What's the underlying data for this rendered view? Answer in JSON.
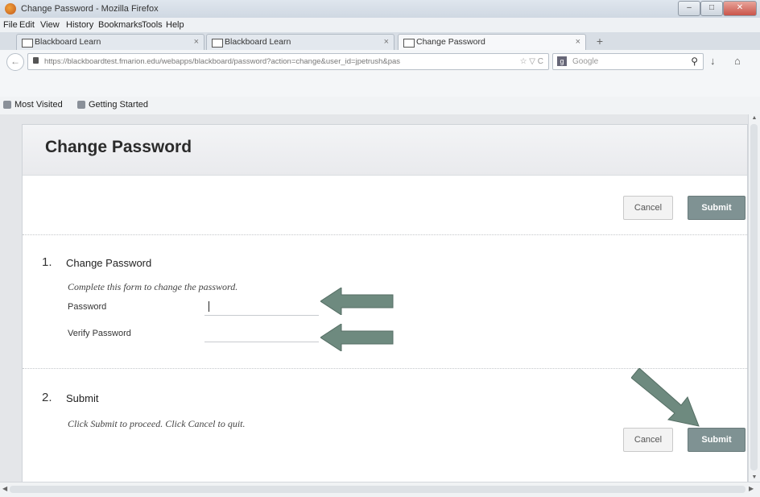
{
  "window": {
    "title": "Change Password - Mozilla Firefox",
    "controls": {
      "minimize": "–",
      "maximize": "□",
      "close": "✕"
    }
  },
  "menu": [
    "File",
    "Edit",
    "View",
    "History",
    "Bookmarks",
    "Tools",
    "Help"
  ],
  "tabs": [
    {
      "label": "Blackboard Learn",
      "close": "×"
    },
    {
      "label": "Blackboard Learn",
      "close": "×"
    },
    {
      "label": "Change Password",
      "close": "×"
    }
  ],
  "new_tab": "+",
  "nav": {
    "url": "https://blackboardtest.fmarion.edu/webapps/blackboard/password?action=change&user_id=jpetrush&pas",
    "search_engine": "Google",
    "search_glyph": "⚲",
    "url_icons": "☆ ▽ C"
  },
  "bookmarks": [
    {
      "label": "Most Visited"
    },
    {
      "label": "Getting Started"
    }
  ],
  "page": {
    "title": "Change Password",
    "top_actions": {
      "cancel": "Cancel",
      "submit": "Submit"
    },
    "step1": {
      "number": "1.",
      "title": "Change Password",
      "instructions": "Complete this form to change the password.",
      "password_label": "Password",
      "verify_label": "Verify Password",
      "password_value": "",
      "verify_value": ""
    },
    "step2": {
      "number": "2.",
      "title": "Submit",
      "instructions": "Click Submit to proceed. Click Cancel to quit."
    },
    "bottom_actions": {
      "cancel": "Cancel",
      "submit": "Submit"
    }
  },
  "colors": {
    "submit_bg": "#7f9293",
    "annotation_arrow": "#6e8a7f"
  }
}
